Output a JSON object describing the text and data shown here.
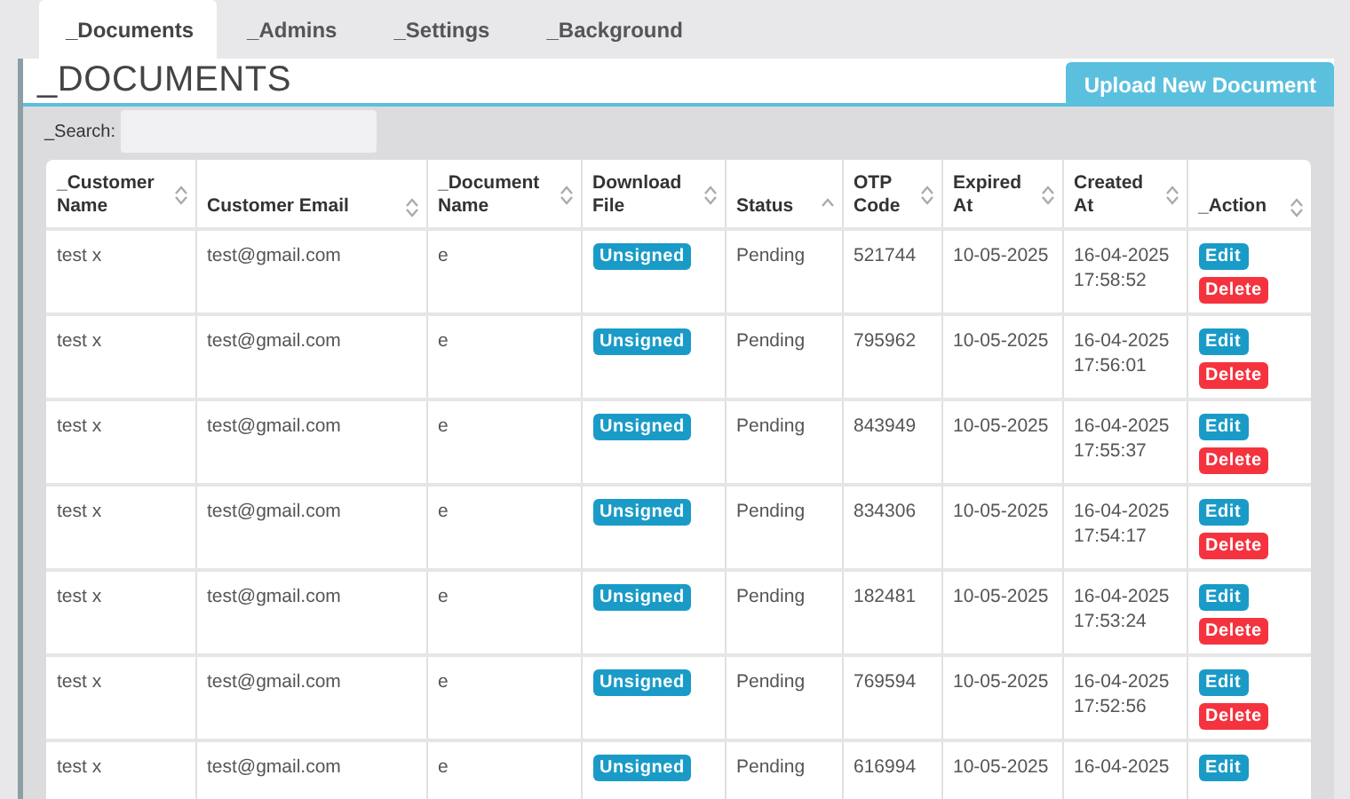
{
  "tabs": [
    {
      "label": "_Documents",
      "selected": true
    },
    {
      "label": "_Admins",
      "selected": false
    },
    {
      "label": "_Settings",
      "selected": false
    },
    {
      "label": "_Background",
      "selected": false
    }
  ],
  "page": {
    "title": "_DOCUMENTS",
    "upload_button": "Upload New Document"
  },
  "search": {
    "label": "_Search:"
  },
  "table": {
    "columns": [
      {
        "label": "_Customer Name",
        "sorted": false
      },
      {
        "label": "Customer Email",
        "sorted": false
      },
      {
        "label": "_Document Name",
        "sorted": false
      },
      {
        "label": "Download File",
        "sorted": false
      },
      {
        "label": "Status",
        "sorted": true
      },
      {
        "label": "OTP Code",
        "sorted": false
      },
      {
        "label": "Expired At",
        "sorted": false
      },
      {
        "label": "Created At",
        "sorted": false
      },
      {
        "label": "_Action",
        "sorted": false
      }
    ],
    "rows": [
      {
        "name": "test x",
        "email": "test@gmail.com",
        "document": "e",
        "file": "Unsigned",
        "status": "Pending",
        "otp": "521744",
        "expired": "10-05-2025",
        "created": [
          "16-04-2025",
          "17:58:52"
        ],
        "actions": [
          {
            "kind": "edit",
            "label": "Edit"
          },
          {
            "kind": "delete",
            "label": "Delete"
          }
        ]
      },
      {
        "name": "test x",
        "email": "test@gmail.com",
        "document": "e",
        "file": "Unsigned",
        "status": "Pending",
        "otp": "795962",
        "expired": "10-05-2025",
        "created": [
          "16-04-2025",
          "17:56:01"
        ],
        "actions": [
          {
            "kind": "edit",
            "label": "Edit"
          },
          {
            "kind": "delete",
            "label": "Delete"
          }
        ]
      },
      {
        "name": "test x",
        "email": "test@gmail.com",
        "document": "e",
        "file": "Unsigned",
        "status": "Pending",
        "otp": "843949",
        "expired": "10-05-2025",
        "created": [
          "16-04-2025",
          "17:55:37"
        ],
        "actions": [
          {
            "kind": "edit",
            "label": "Edit"
          },
          {
            "kind": "delete",
            "label": "Delete"
          }
        ]
      },
      {
        "name": "test x",
        "email": "test@gmail.com",
        "document": "e",
        "file": "Unsigned",
        "status": "Pending",
        "otp": "834306",
        "expired": "10-05-2025",
        "created": [
          "16-04-2025",
          "17:54:17"
        ],
        "actions": [
          {
            "kind": "edit",
            "label": "Edit"
          },
          {
            "kind": "delete",
            "label": "Delete"
          }
        ]
      },
      {
        "name": "test x",
        "email": "test@gmail.com",
        "document": "e",
        "file": "Unsigned",
        "status": "Pending",
        "otp": "182481",
        "expired": "10-05-2025",
        "created": [
          "16-04-2025",
          "17:53:24"
        ],
        "actions": [
          {
            "kind": "edit",
            "label": "Edit"
          },
          {
            "kind": "delete",
            "label": "Delete"
          }
        ]
      },
      {
        "name": "test x",
        "email": "test@gmail.com",
        "document": "e",
        "file": "Unsigned",
        "status": "Pending",
        "otp": "769594",
        "expired": "10-05-2025",
        "created": [
          "16-04-2025",
          "17:52:56"
        ],
        "actions": [
          {
            "kind": "edit",
            "label": "Edit"
          },
          {
            "kind": "delete",
            "label": "Delete"
          }
        ]
      },
      {
        "name": "test x",
        "email": "test@gmail.com",
        "document": "e",
        "file": "Unsigned",
        "status": "Pending",
        "otp": "616994",
        "expired": "10-05-2025",
        "created": [
          "16-04-2025"
        ],
        "actions": [
          {
            "kind": "edit",
            "label": "Edit"
          }
        ]
      }
    ]
  }
}
